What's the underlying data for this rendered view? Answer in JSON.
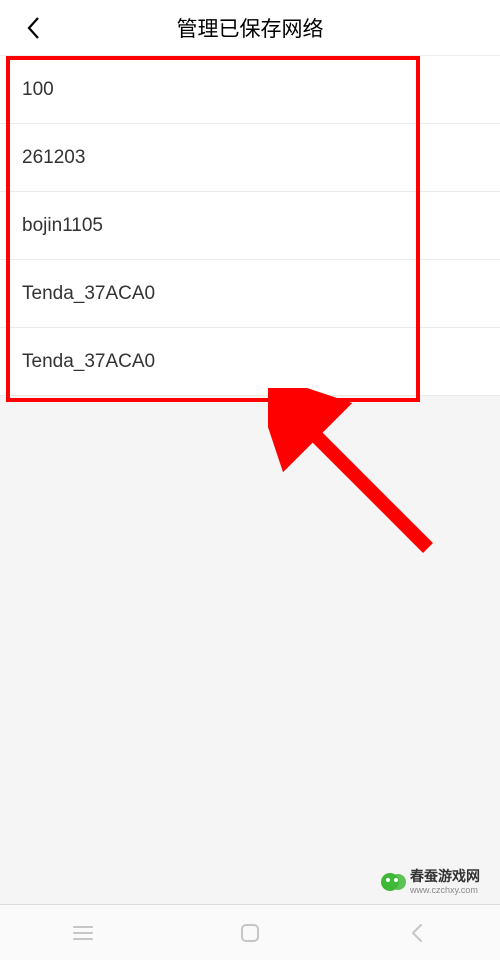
{
  "header": {
    "title": "管理已保存网络"
  },
  "networks": [
    {
      "name": "100"
    },
    {
      "name": "261203"
    },
    {
      "name": "bojin1105"
    },
    {
      "name": "Tenda_37ACA0"
    },
    {
      "name": "Tenda_37ACA0"
    }
  ],
  "watermark": {
    "line1": "春蚕游戏网",
    "line2": "www.czchxy.com"
  }
}
